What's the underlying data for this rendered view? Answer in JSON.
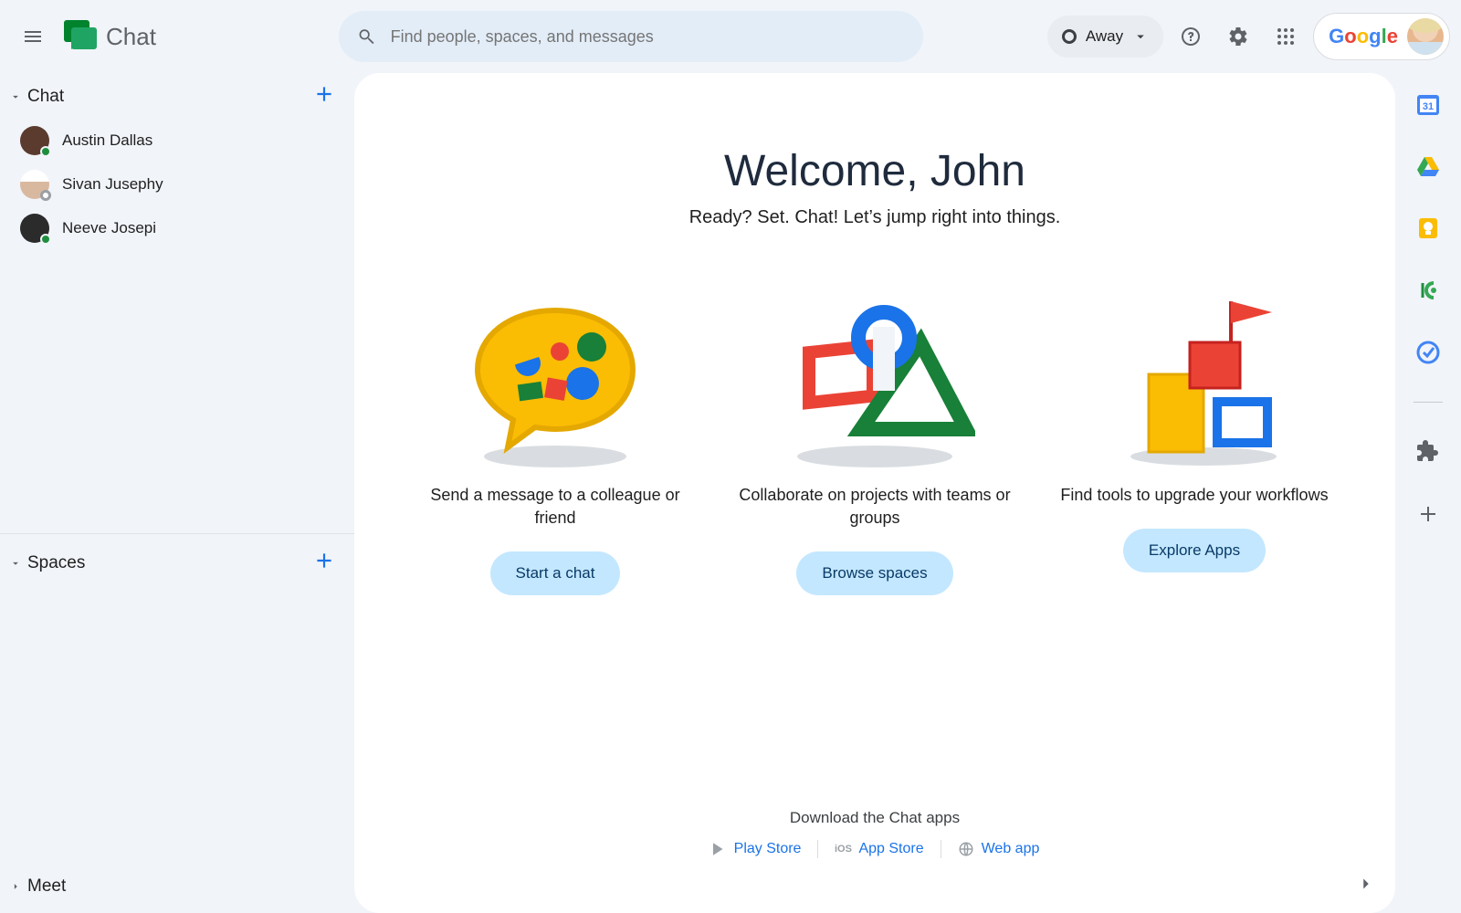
{
  "app": {
    "title": "Chat"
  },
  "search": {
    "placeholder": "Find people, spaces, and messages"
  },
  "status": {
    "label": "Away"
  },
  "brand": {
    "word": "Google"
  },
  "sidebar": {
    "sections": {
      "chat": {
        "label": "Chat"
      },
      "spaces": {
        "label": "Spaces"
      },
      "meet": {
        "label": "Meet"
      }
    },
    "contacts": [
      {
        "name": "Austin Dallas",
        "presence": "online"
      },
      {
        "name": "Sivan Jusephy",
        "presence": "offline"
      },
      {
        "name": "Neeve Josepi",
        "presence": "online"
      }
    ]
  },
  "welcome": {
    "title": "Welcome, John",
    "subtitle": "Ready? Set. Chat! Let’s jump right into things."
  },
  "cards": [
    {
      "desc": "Send a message to a colleague or friend",
      "button": "Start a chat"
    },
    {
      "desc": "Collaborate on projects with teams or groups",
      "button": "Browse spaces"
    },
    {
      "desc": "Find tools to upgrade your workflows",
      "button": "Explore Apps"
    }
  ],
  "download": {
    "title": "Download the Chat apps",
    "stores": [
      {
        "label": "Play Store"
      },
      {
        "label": "App Store"
      },
      {
        "label": "Web app"
      }
    ]
  },
  "rail": {
    "items": [
      "calendar",
      "drive",
      "keep",
      "contacts",
      "tasks"
    ],
    "extras": [
      "extensions",
      "add"
    ]
  }
}
